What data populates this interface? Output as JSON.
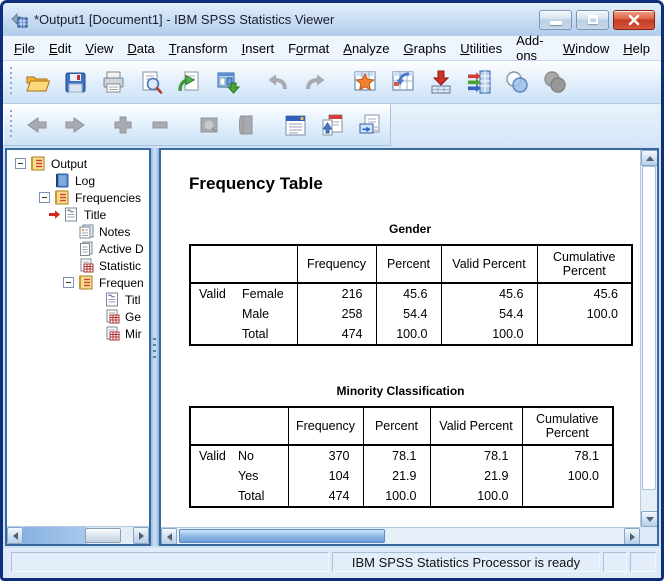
{
  "window": {
    "title": "*Output1 [Document1] - IBM SPSS Statistics Viewer",
    "controls": [
      "minimize",
      "maximize",
      "close"
    ]
  },
  "colors": {
    "window_border": "#0d2f7b",
    "pane_border": "#39689f",
    "close_button": "#c23a24",
    "titlebar": "#c6dbf2",
    "toolbar": "#e2effb",
    "table_border": "#000000"
  },
  "menu": {
    "items": [
      {
        "pre": "",
        "key": "F",
        "post": "ile"
      },
      {
        "pre": "",
        "key": "E",
        "post": "dit"
      },
      {
        "pre": "",
        "key": "V",
        "post": "iew"
      },
      {
        "pre": "",
        "key": "D",
        "post": "ata"
      },
      {
        "pre": "",
        "key": "T",
        "post": "ransform"
      },
      {
        "pre": "",
        "key": "I",
        "post": "nsert"
      },
      {
        "pre": "F",
        "key": "o",
        "post": "rmat"
      },
      {
        "pre": "",
        "key": "A",
        "post": "nalyze"
      },
      {
        "pre": "",
        "key": "G",
        "post": "raphs"
      },
      {
        "pre": "",
        "key": "U",
        "post": "tilities"
      },
      {
        "pre": "Add-",
        "key": "o",
        "post": "ns"
      },
      {
        "pre": "",
        "key": "W",
        "post": "indow"
      },
      {
        "pre": "",
        "key": "H",
        "post": "elp"
      }
    ]
  },
  "toolbar_primary": {
    "icons": [
      "open-file",
      "save",
      "print",
      "print-preview",
      "recall-dialog",
      "export-output",
      "undo",
      "redo",
      "goto-data",
      "goto-case",
      "variables",
      "variable-info",
      "select-cases",
      "split-file"
    ]
  },
  "toolbar_outline": {
    "icons": [
      "back",
      "forward",
      "promote",
      "demote",
      "show",
      "hide",
      "select-last-output",
      "designate-window",
      "insert-text"
    ]
  },
  "tree": {
    "items": [
      {
        "label": "Output",
        "level": 0,
        "icon": "notebook",
        "expanded": true
      },
      {
        "label": "Log",
        "level": 1,
        "icon": "log"
      },
      {
        "label": "Frequencies",
        "level": 1,
        "icon": "notebook",
        "expanded": true
      },
      {
        "label": "Title",
        "level": 2,
        "icon": "title",
        "current": true
      },
      {
        "label": "Notes",
        "level": 2,
        "icon": "notes"
      },
      {
        "label": "Active D",
        "level": 2,
        "icon": "dataset"
      },
      {
        "label": "Statistic",
        "level": 2,
        "icon": "stats-table"
      },
      {
        "label": "Frequen",
        "level": 2,
        "icon": "notebook",
        "expanded": true
      },
      {
        "label": "Titl",
        "level": 3,
        "icon": "title"
      },
      {
        "label": "Ge",
        "level": 3,
        "icon": "stats-table"
      },
      {
        "label": "Mir",
        "level": 3,
        "icon": "stats-table"
      }
    ]
  },
  "content": {
    "heading": "Frequency Table",
    "tables": [
      {
        "title": "Gender",
        "columns": [
          "Frequency",
          "Percent",
          "Valid Percent",
          "Cumulative Percent"
        ],
        "rows": [
          [
            "Valid",
            "Female",
            "216",
            "45.6",
            "45.6",
            "45.6"
          ],
          [
            "",
            "Male",
            "258",
            "54.4",
            "54.4",
            "100.0"
          ],
          [
            "",
            "Total",
            "474",
            "100.0",
            "100.0",
            ""
          ]
        ]
      },
      {
        "title": "Minority Classification",
        "columns": [
          "Frequency",
          "Percent",
          "Valid Percent",
          "Cumulative Percent"
        ],
        "rows": [
          [
            "Valid",
            "No",
            "370",
            "78.1",
            "78.1",
            "78.1"
          ],
          [
            "",
            "Yes",
            "104",
            "21.9",
            "21.9",
            "100.0"
          ],
          [
            "",
            "Total",
            "474",
            "100.0",
            "100.0",
            ""
          ]
        ]
      }
    ]
  },
  "status": {
    "message": "IBM SPSS Statistics Processor is ready"
  }
}
